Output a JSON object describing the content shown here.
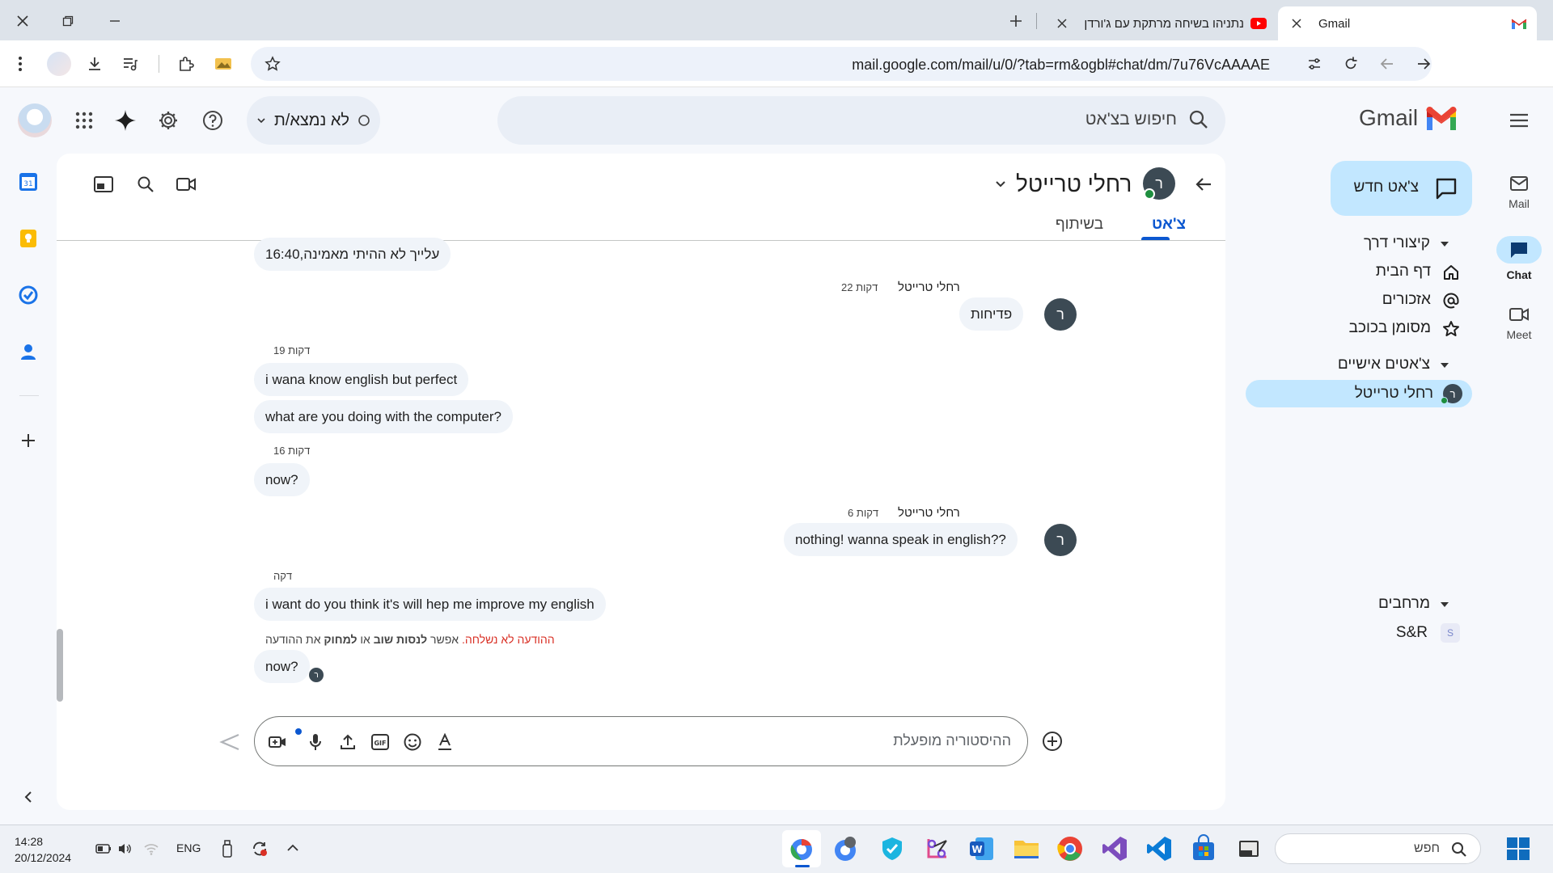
{
  "browser": {
    "tabs": [
      {
        "title": "Gmail",
        "favicon": "gmail-icon",
        "active": true
      },
      {
        "title": "נתניהו בשיחה מרתקת עם ג'ורדן",
        "favicon": "youtube-icon",
        "active": false
      }
    ],
    "url": "mail.google.com/mail/u/0/?tab=rm&ogbl#chat/dm/7u76VcAAAAE"
  },
  "gmail": {
    "logo_text": "Gmail",
    "search_placeholder": "חיפוש בצ'אט",
    "status_label": "לא נמצא/ת",
    "rail": [
      {
        "label": "Mail",
        "icon": "mail-icon"
      },
      {
        "label": "Chat",
        "icon": "chat-icon",
        "active": true
      },
      {
        "label": "Meet",
        "icon": "meet-icon"
      }
    ],
    "new_chat_label": "צ'אט חדש",
    "shortcuts_header": "קיצורי דרך",
    "shortcuts": [
      {
        "label": "דף הבית",
        "icon": "home-icon"
      },
      {
        "label": "אזכורים",
        "icon": "at-icon"
      },
      {
        "label": "מסומן בכוכב",
        "icon": "star-icon"
      }
    ],
    "dms_header": "צ'אטים אישיים",
    "dms": [
      {
        "label": "רחלי טרייטל",
        "avatar": "ר"
      }
    ],
    "spaces_header": "מרחבים",
    "spaces": [
      {
        "label": "S&R",
        "avatar": "S"
      }
    ]
  },
  "chat": {
    "contact_name": "רחלי טרייטל",
    "avatar_letter": "ר",
    "tabs": [
      {
        "label": "צ'אט",
        "active": true
      },
      {
        "label": "בשיתוף",
        "active": false
      }
    ],
    "messages": {
      "m0": "עלייך לא ההיתי מאמינה,16:40",
      "g1_name": "רחלי טרייטל",
      "g1_time": "22 דקות",
      "m1": "פדיחות",
      "g2_time": "19 דקות",
      "m2": "i wana know english but perfect",
      "m3": "what are you doing with the computer?",
      "g3_time": "16 דקות",
      "m4": "now?",
      "g4_name": "רחלי טרייטל",
      "g4_time": "6 דקות",
      "m5": "nothing! wanna speak in english??",
      "g5_time": "דקה",
      "m6": "i want do you think it's will hep me improve my english",
      "error_red": "ההודעה לא נשלחה.",
      "error_mid1": " אפשר ",
      "error_retry": "לנסות שוב",
      "error_mid2": " או ",
      "error_delete": "למחוק",
      "error_end": " את ההודעה",
      "m7": "now?"
    },
    "composer_placeholder": "ההיסטוריה מופעלת"
  },
  "taskbar": {
    "time": "14:28",
    "date": "20/12/2024",
    "lang": "ENG",
    "search_placeholder": "חפש"
  },
  "colors": {
    "accent": "#0b57d0",
    "active_pill": "#c2e7ff",
    "bubble": "#f0f4f9",
    "error": "#d93025",
    "avatar": "#3c4a54",
    "presence": "#1e8e3e"
  }
}
